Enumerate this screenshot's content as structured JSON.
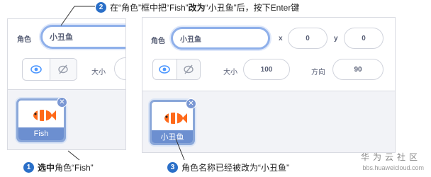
{
  "step1": {
    "num": "1",
    "bold": "选中",
    "text": "角色“Fish”"
  },
  "step2": {
    "num": "2",
    "text_a": "在“角色”框中把“Fish”",
    "bold": "改为",
    "text_b": "“小丑鱼”后，按下Enter键"
  },
  "step3": {
    "num": "3",
    "text": "角色名称已经被改为“小丑鱼”"
  },
  "left_panel": {
    "sprite_label": "角色",
    "sprite_name_value": "小丑鱼",
    "size_label": "大小",
    "sprite_card_name": "Fish"
  },
  "right_panel": {
    "sprite_label": "角色",
    "sprite_name_value": "小丑鱼",
    "x_label": "x",
    "x_value": "0",
    "y_label": "y",
    "y_value": "0",
    "size_label": "大小",
    "size_value": "100",
    "direction_label": "方向",
    "direction_value": "90",
    "sprite_card_name": "小丑鱼"
  },
  "watermark": {
    "brand": "华为云社区",
    "url": "bbs.huaweicloud.com"
  },
  "colors": {
    "accent": "#2a6fc8",
    "card_label": "#6c8fd0",
    "focus_border": "#8fb0ea"
  }
}
